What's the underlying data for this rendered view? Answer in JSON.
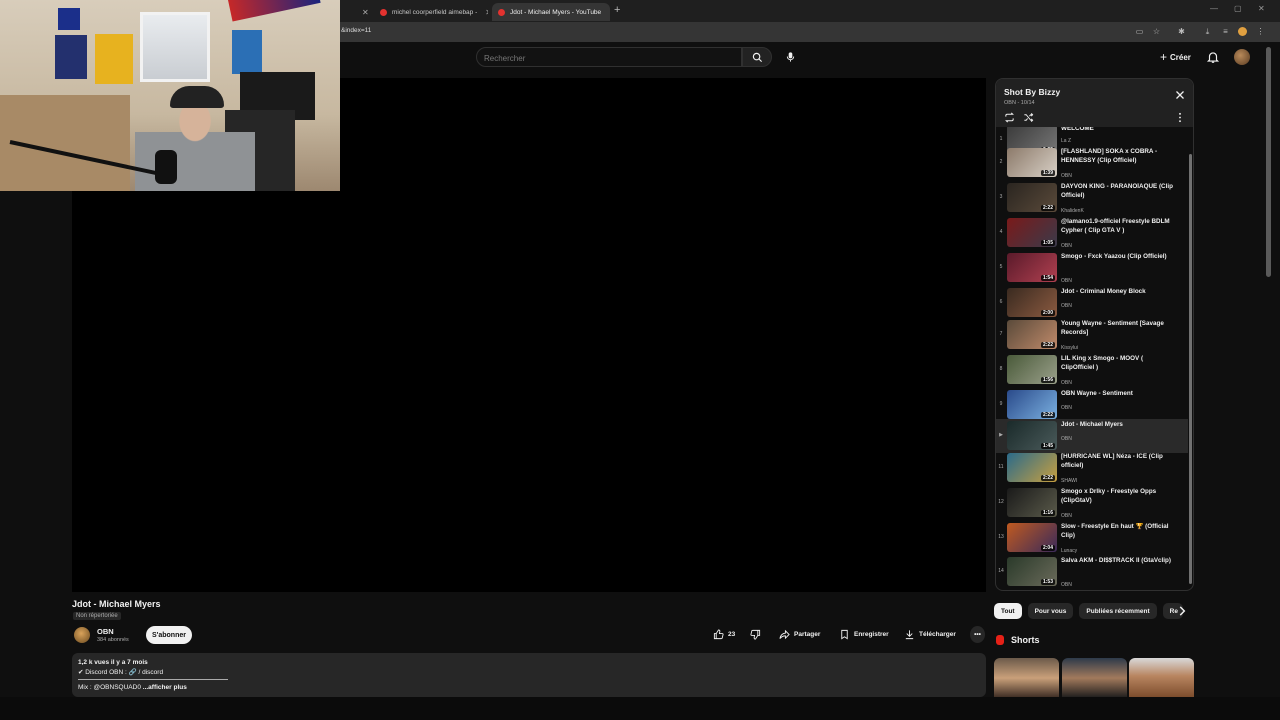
{
  "browser": {
    "tabs": [
      {
        "label": "michel coorperfield aimebap -"
      },
      {
        "label": "Jdot - Michael Myers - YouTube"
      }
    ],
    "url": "&index=11"
  },
  "header": {
    "search_placeholder": "Rechercher",
    "create_label": "Créer"
  },
  "video": {
    "title": "Jdot - Michael Myers",
    "visibility": "Non répertoriée",
    "channel": "OBN",
    "subscribers": "384 abonnés",
    "subscribe_label": "S'abonner",
    "likes": "23",
    "share_label": "Partager",
    "save_label": "Enregistrer",
    "download_label": "Télécharger",
    "description": {
      "meta": "1,2 k vues  il y a 7 mois",
      "line1": "✔ Discord OBN :   🔗 / discord",
      "line3": "Mix : @OBNSQUAD0",
      "more": "...afficher plus"
    }
  },
  "playlist": {
    "title": "Shot By Bizzy",
    "subtitle": "OBN - 10/14",
    "items": [
      {
        "index": "1",
        "title": "WELCOME",
        "channel": "La Z",
        "duration": "2:25"
      },
      {
        "index": "2",
        "title": "[FLASHLAND] SOKA x COBRA - HENNESSY (Clip Officiel)",
        "channel": "OBN",
        "duration": "1:39"
      },
      {
        "index": "3",
        "title": "DAYVON KING - PARANOÏAQUE (Clip Officiel)",
        "channel": "KhalidenK",
        "duration": "2:22"
      },
      {
        "index": "4",
        "title": "@lamano1.9-officiel Freestyle BDLM Cypher ( Clip GTA V )",
        "channel": "OBN",
        "duration": "1:05"
      },
      {
        "index": "5",
        "title": "Smogo - Fxck Yaazou (Clip Officiel)",
        "channel": "OBN",
        "duration": "1:54"
      },
      {
        "index": "6",
        "title": "Jdot - Criminal Money Block",
        "channel": "OBN",
        "duration": "2:00"
      },
      {
        "index": "7",
        "title": "Young Wayne - Sentiment [Savage Records]",
        "channel": "Kissylui",
        "duration": "2:22"
      },
      {
        "index": "8",
        "title": "LIL King x Smogo - MOOV ( ClipOfficiel )",
        "channel": "OBN",
        "duration": "1:56"
      },
      {
        "index": "9",
        "title": "OBN Wayne - Sentiment",
        "channel": "OBN",
        "duration": "2:22"
      },
      {
        "index": "▶",
        "title": "Jdot - Michael Myers",
        "channel": "OBN",
        "duration": "1:45"
      },
      {
        "index": "11",
        "title": "[HURRICANE WL] Néza - ICE (Clip officiel)",
        "channel": "SHAWI",
        "duration": "2:22"
      },
      {
        "index": "12",
        "title": "Smogo x Drlky - Freestyle Opps (ClipGtaV)",
        "channel": "OBN",
        "duration": "1:16"
      },
      {
        "index": "13",
        "title": "Slow - Freestyle En haut 🏆 (Official Clip)",
        "channel": "Lunacy",
        "duration": "2:04"
      },
      {
        "index": "14",
        "title": "Salva AKM - DI$$TRACK II (GtaVclip)",
        "channel": "OBN",
        "duration": "1:53"
      }
    ]
  },
  "chips": [
    "Tout",
    "Pour vous",
    "Publiées récemment",
    "Re"
  ],
  "shorts": {
    "title": "Shorts"
  },
  "colors": {
    "accent": "#ff0000",
    "background": "#0f0f0f",
    "panel": "#212121"
  }
}
